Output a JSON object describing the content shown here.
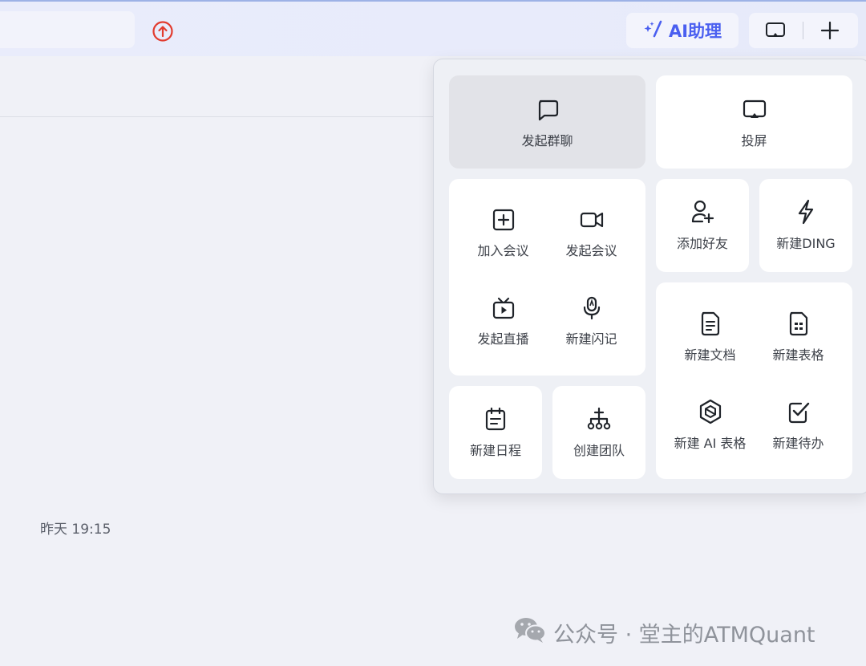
{
  "topbar": {
    "ai_label": "AI助理"
  },
  "main": {
    "timestamp": "昨天 19:15"
  },
  "popup": {
    "start_group_chat": "发起群聊",
    "screen_cast": "投屏",
    "join_meeting": "加入会议",
    "start_meeting": "发起会议",
    "start_live": "发起直播",
    "new_flash_note": "新建闪记",
    "add_friend": "添加好友",
    "new_ding": "新建DING",
    "new_doc": "新建文档",
    "new_sheet": "新建表格",
    "new_ai_sheet": "新建 AI 表格",
    "new_todo": "新建待办",
    "new_schedule": "新建日程",
    "create_team": "创建团队"
  },
  "watermark": {
    "text": "公众号 · 堂主的ATMQuant"
  },
  "colors": {
    "accent": "#4a5ff0",
    "upload_red": "#e23b2e",
    "highlight_card": "#e2e3e8"
  }
}
